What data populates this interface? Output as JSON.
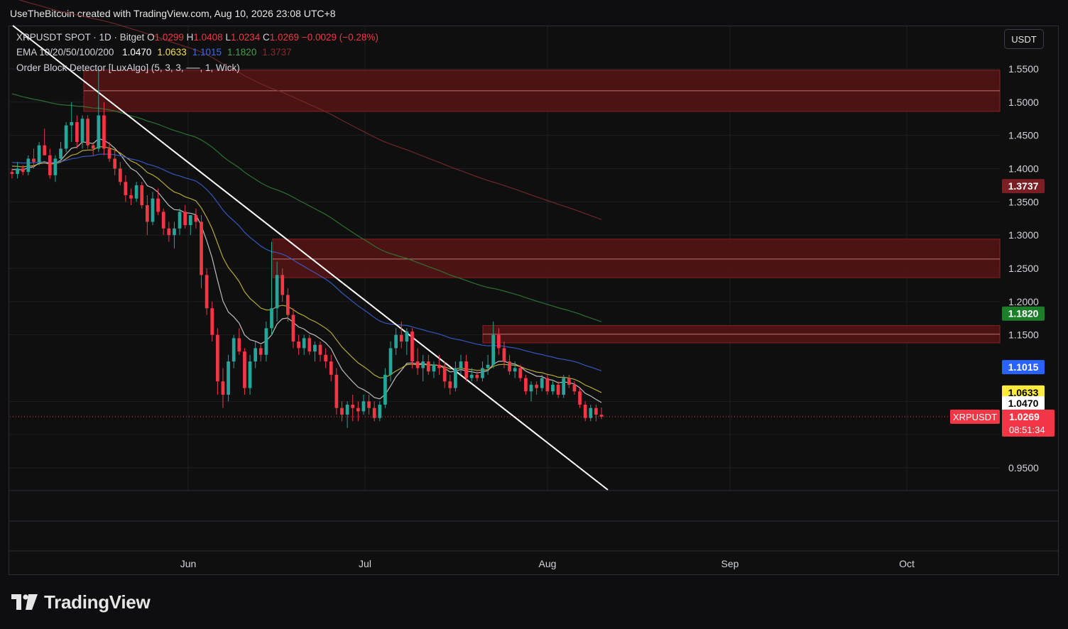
{
  "header": {
    "title": "UseTheBitcoin created with TradingView.com, Aug 10, 2026 23:08 UTC+8"
  },
  "legend": {
    "symbol_line": "XRPUSDT SPOT · 1D · Bitget",
    "ohlc": [
      {
        "label": "O",
        "value": "1.0299"
      },
      {
        "label": "H",
        "value": "1.0408"
      },
      {
        "label": "L",
        "value": "1.0234"
      },
      {
        "label": "C",
        "value": "1.0269"
      }
    ],
    "change": "−0.0029 (−0.28%)",
    "ema_label": "EMA 10/20/50/100/200",
    "ema_values": [
      {
        "value": "1.0470",
        "color": "#ffffff"
      },
      {
        "value": "1.0633",
        "color": "#f5e04a"
      },
      {
        "value": "1.1015",
        "color": "#3a6df0"
      },
      {
        "value": "1.1820",
        "color": "#43a047"
      },
      {
        "value": "1.3737",
        "color": "#8b2a2a"
      }
    ],
    "indicator": "Order Block Detector [LuxAlgo] (5, 3, 3, ──, 1, Wick)"
  },
  "currency": "USDT",
  "price_labels": {
    "ema200": "1.3737",
    "ema100": "1.1820",
    "ema50": "1.1015",
    "ema20": "1.0633",
    "ema10": "1.0470",
    "symbol": "XRPUSDT",
    "last": "1.0269",
    "countdown": "08:51:34"
  },
  "colors": {
    "up": "#26a69a",
    "down": "#f23645",
    "ema10": "#cfcfcf",
    "ema20": "#c9b838",
    "ema50": "#3a5fcf",
    "ema100": "#2e7d32",
    "ema200": "#7a2a2a",
    "orderblock": "#5a1414"
  },
  "brand": "TradingView",
  "chart_data": {
    "type": "candlestick",
    "symbol": "XRPUSDT",
    "timeframe": "1D",
    "y_ticks": [
      "1.5500",
      "1.5000",
      "1.4500",
      "1.4000",
      "1.3500",
      "1.3000",
      "1.2500",
      "1.2000",
      "1.1500",
      "0.9500"
    ],
    "x_ticks": [
      "Jun",
      "Jul",
      "Aug",
      "Sep",
      "Oct"
    ],
    "ylim": [
      0.92,
      1.6
    ],
    "candles": [
      [
        1.395,
        1.4,
        1.385,
        1.392
      ],
      [
        1.392,
        1.41,
        1.385,
        1.4
      ],
      [
        1.4,
        1.405,
        1.39,
        1.395
      ],
      [
        1.395,
        1.42,
        1.39,
        1.415
      ],
      [
        1.415,
        1.43,
        1.4,
        1.41
      ],
      [
        1.41,
        1.44,
        1.405,
        1.435
      ],
      [
        1.435,
        1.46,
        1.42,
        1.42
      ],
      [
        1.42,
        1.43,
        1.385,
        1.39
      ],
      [
        1.39,
        1.42,
        1.38,
        1.415
      ],
      [
        1.415,
        1.44,
        1.41,
        1.43
      ],
      [
        1.43,
        1.47,
        1.425,
        1.465
      ],
      [
        1.465,
        1.5,
        1.44,
        1.47
      ],
      [
        1.47,
        1.48,
        1.43,
        1.44
      ],
      [
        1.44,
        1.48,
        1.43,
        1.475
      ],
      [
        1.475,
        1.48,
        1.43,
        1.435
      ],
      [
        1.435,
        1.44,
        1.42,
        1.43
      ],
      [
        1.43,
        1.55,
        1.425,
        1.48
      ],
      [
        1.48,
        1.5,
        1.42,
        1.43
      ],
      [
        1.43,
        1.44,
        1.41,
        1.415
      ],
      [
        1.415,
        1.43,
        1.39,
        1.4
      ],
      [
        1.4,
        1.41,
        1.375,
        1.38
      ],
      [
        1.38,
        1.39,
        1.35,
        1.36
      ],
      [
        1.36,
        1.37,
        1.345,
        1.355
      ],
      [
        1.355,
        1.38,
        1.35,
        1.375
      ],
      [
        1.375,
        1.38,
        1.34,
        1.345
      ],
      [
        1.345,
        1.36,
        1.3,
        1.32
      ],
      [
        1.32,
        1.365,
        1.315,
        1.355
      ],
      [
        1.355,
        1.37,
        1.33,
        1.335
      ],
      [
        1.335,
        1.34,
        1.3,
        1.31
      ],
      [
        1.31,
        1.32,
        1.29,
        1.3
      ],
      [
        1.3,
        1.32,
        1.28,
        1.31
      ],
      [
        1.31,
        1.34,
        1.3,
        1.335
      ],
      [
        1.335,
        1.345,
        1.31,
        1.315
      ],
      [
        1.315,
        1.33,
        1.3,
        1.33
      ],
      [
        1.33,
        1.34,
        1.31,
        1.32
      ],
      [
        1.32,
        1.33,
        1.22,
        1.24
      ],
      [
        1.24,
        1.25,
        1.18,
        1.19
      ],
      [
        1.19,
        1.2,
        1.14,
        1.15
      ],
      [
        1.15,
        1.16,
        1.06,
        1.08
      ],
      [
        1.08,
        1.1,
        1.04,
        1.06
      ],
      [
        1.06,
        1.12,
        1.05,
        1.11
      ],
      [
        1.11,
        1.15,
        1.1,
        1.145
      ],
      [
        1.145,
        1.16,
        1.12,
        1.125
      ],
      [
        1.125,
        1.13,
        1.06,
        1.07
      ],
      [
        1.07,
        1.12,
        1.06,
        1.11
      ],
      [
        1.11,
        1.14,
        1.1,
        1.13
      ],
      [
        1.13,
        1.135,
        1.11,
        1.12
      ],
      [
        1.12,
        1.17,
        1.11,
        1.16
      ],
      [
        1.16,
        1.29,
        1.15,
        1.19
      ],
      [
        1.19,
        1.26,
        1.17,
        1.24
      ],
      [
        1.24,
        1.25,
        1.2,
        1.21
      ],
      [
        1.21,
        1.22,
        1.17,
        1.18
      ],
      [
        1.18,
        1.19,
        1.13,
        1.14
      ],
      [
        1.14,
        1.15,
        1.12,
        1.13
      ],
      [
        1.13,
        1.15,
        1.12,
        1.145
      ],
      [
        1.145,
        1.15,
        1.12,
        1.125
      ],
      [
        1.125,
        1.14,
        1.11,
        1.135
      ],
      [
        1.135,
        1.14,
        1.11,
        1.12
      ],
      [
        1.12,
        1.13,
        1.1,
        1.11
      ],
      [
        1.11,
        1.12,
        1.08,
        1.09
      ],
      [
        1.09,
        1.1,
        1.03,
        1.04
      ],
      [
        1.04,
        1.05,
        1.02,
        1.03
      ],
      [
        1.03,
        1.05,
        1.01,
        1.045
      ],
      [
        1.045,
        1.06,
        1.02,
        1.04
      ],
      [
        1.04,
        1.05,
        1.02,
        1.035
      ],
      [
        1.035,
        1.06,
        1.03,
        1.05
      ],
      [
        1.05,
        1.06,
        1.03,
        1.04
      ],
      [
        1.04,
        1.05,
        1.02,
        1.025
      ],
      [
        1.025,
        1.05,
        1.02,
        1.045
      ],
      [
        1.045,
        1.1,
        1.04,
        1.09
      ],
      [
        1.09,
        1.14,
        1.08,
        1.13
      ],
      [
        1.13,
        1.16,
        1.12,
        1.15
      ],
      [
        1.15,
        1.17,
        1.13,
        1.14
      ],
      [
        1.14,
        1.16,
        1.12,
        1.155
      ],
      [
        1.155,
        1.16,
        1.1,
        1.11
      ],
      [
        1.11,
        1.13,
        1.09,
        1.1
      ],
      [
        1.1,
        1.12,
        1.08,
        1.11
      ],
      [
        1.11,
        1.12,
        1.09,
        1.095
      ],
      [
        1.095,
        1.11,
        1.085,
        1.105
      ],
      [
        1.105,
        1.12,
        1.09,
        1.1
      ],
      [
        1.1,
        1.11,
        1.07,
        1.08
      ],
      [
        1.08,
        1.09,
        1.06,
        1.07
      ],
      [
        1.07,
        1.11,
        1.065,
        1.1
      ],
      [
        1.1,
        1.12,
        1.09,
        1.11
      ],
      [
        1.11,
        1.12,
        1.08,
        1.085
      ],
      [
        1.085,
        1.1,
        1.08,
        1.09
      ],
      [
        1.09,
        1.095,
        1.08,
        1.085
      ],
      [
        1.085,
        1.11,
        1.08,
        1.1
      ],
      [
        1.1,
        1.12,
        1.09,
        1.105
      ],
      [
        1.105,
        1.17,
        1.1,
        1.15
      ],
      [
        1.15,
        1.16,
        1.12,
        1.13
      ],
      [
        1.13,
        1.14,
        1.1,
        1.11
      ],
      [
        1.11,
        1.12,
        1.09,
        1.095
      ],
      [
        1.095,
        1.11,
        1.085,
        1.1
      ],
      [
        1.1,
        1.105,
        1.08,
        1.085
      ],
      [
        1.085,
        1.09,
        1.06,
        1.065
      ],
      [
        1.065,
        1.08,
        1.05,
        1.075
      ],
      [
        1.075,
        1.08,
        1.06,
        1.07
      ],
      [
        1.07,
        1.09,
        1.065,
        1.085
      ],
      [
        1.085,
        1.09,
        1.06,
        1.065
      ],
      [
        1.065,
        1.08,
        1.06,
        1.075
      ],
      [
        1.075,
        1.08,
        1.055,
        1.06
      ],
      [
        1.06,
        1.09,
        1.055,
        1.085
      ],
      [
        1.085,
        1.09,
        1.07,
        1.075
      ],
      [
        1.075,
        1.08,
        1.06,
        1.065
      ],
      [
        1.065,
        1.07,
        1.04,
        1.045
      ],
      [
        1.045,
        1.05,
        1.02,
        1.025
      ],
      [
        1.025,
        1.045,
        1.02,
        1.04
      ],
      [
        1.04,
        1.045,
        1.02,
        1.03
      ],
      [
        1.0299,
        1.0408,
        1.0234,
        1.0269
      ]
    ],
    "ema": [
      {
        "name": "EMA 10",
        "value": 1.047
      },
      {
        "name": "EMA 20",
        "value": 1.0633
      },
      {
        "name": "EMA 50",
        "value": 1.1015
      },
      {
        "name": "EMA 100",
        "value": 1.182
      },
      {
        "name": "EMA 200",
        "value": 1.3737
      }
    ],
    "order_blocks": [
      {
        "top": 1.548,
        "mid": 1.517,
        "bottom": 1.486
      },
      {
        "top": 1.294,
        "mid": 1.264,
        "bottom": 1.236
      },
      {
        "top": 1.164,
        "mid": 1.151,
        "bottom": 1.138
      }
    ]
  }
}
